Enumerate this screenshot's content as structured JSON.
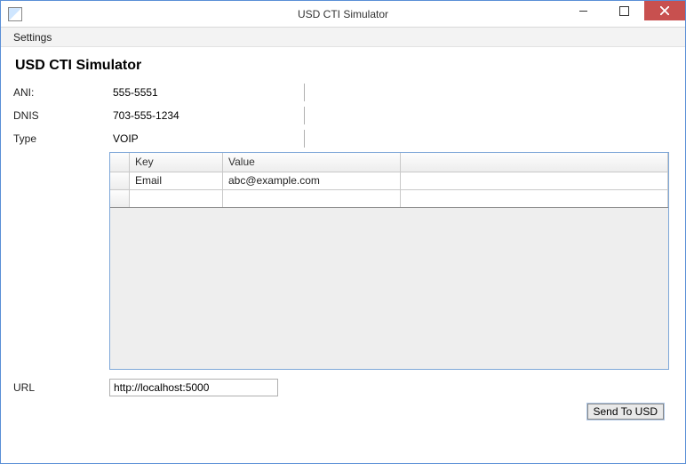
{
  "window": {
    "title": "USD CTI Simulator"
  },
  "menu": {
    "settings": "Settings"
  },
  "page": {
    "heading": "USD CTI Simulator"
  },
  "fields": {
    "ani": {
      "label": "ANI:",
      "value": "555-5551"
    },
    "dnis": {
      "label": "DNIS",
      "value": "703-555-1234"
    },
    "type": {
      "label": "Type",
      "value": "VOIP"
    },
    "url": {
      "label": "URL",
      "value": "http://localhost:5000"
    }
  },
  "grid": {
    "headers": {
      "key": "Key",
      "value": "Value"
    },
    "rows": [
      {
        "key": "Email",
        "value": "abc@example.com"
      }
    ]
  },
  "actions": {
    "send": "Send To USD"
  }
}
